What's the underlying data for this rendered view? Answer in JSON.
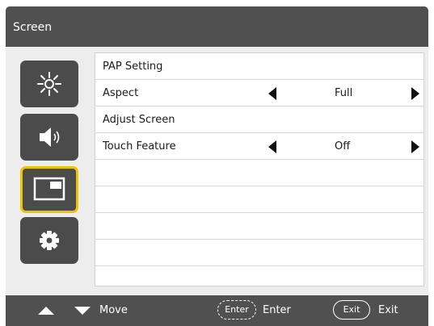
{
  "window": {
    "title": "Screen"
  },
  "sidebar": {
    "items": [
      {
        "name": "brightness",
        "icon": "sun-icon",
        "active": false
      },
      {
        "name": "audio",
        "icon": "speaker-icon",
        "active": false
      },
      {
        "name": "screen",
        "icon": "screen-pip-icon",
        "active": true
      },
      {
        "name": "settings",
        "icon": "gear-icon",
        "active": false
      }
    ],
    "active_border_color": "#f2c200"
  },
  "menu": {
    "rows": [
      {
        "label": "PAP Setting"
      },
      {
        "label": "Aspect",
        "value": "Full"
      },
      {
        "label": "Adjust Screen"
      },
      {
        "label": "Touch Feature",
        "value": "Off"
      }
    ]
  },
  "footer": {
    "move_label": "Move",
    "enter_key": "Enter",
    "enter_label": "Enter",
    "exit_key": "Exit",
    "exit_label": "Exit"
  }
}
